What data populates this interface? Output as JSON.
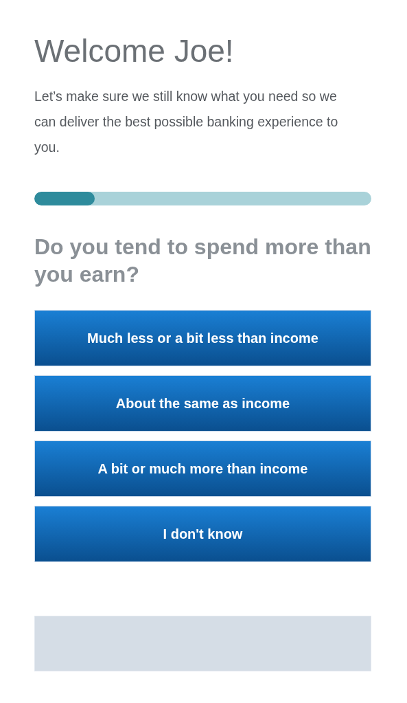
{
  "heading": "Welcome Joe!",
  "intro": "Let’s make sure we still know what you need so we can deliver the best possible banking experience to you.",
  "progress": {
    "level": 0.18
  },
  "question": "Do you tend to spend more than you earn?",
  "answers": [
    {
      "label": "Much less or a bit less than income"
    },
    {
      "label": "About the same as income"
    },
    {
      "label": "A bit or much more than income"
    },
    {
      "label": "I don't know"
    }
  ],
  "continue_button": {
    "disabled": true
  }
}
